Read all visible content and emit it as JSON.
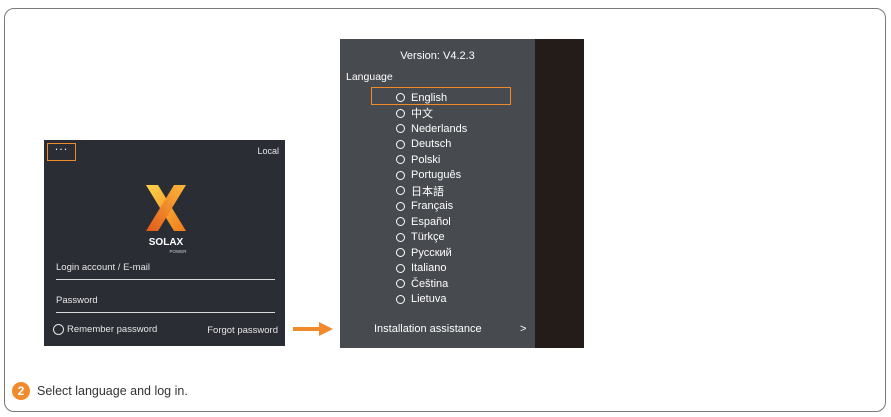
{
  "login": {
    "more_label": "···",
    "local_label": "Local",
    "brand_text": "SOLAX",
    "brand_sub": "POWER",
    "account_label": "Login account / E-mail",
    "password_label": "Password",
    "remember_label": "Remember password",
    "forgot_label": "Forgot password"
  },
  "menu": {
    "version": "Version: V4.2.3",
    "language_title": "Language",
    "languages": [
      "English",
      "中文",
      "Nederlands",
      "Deutsch",
      "Polski",
      "Português",
      "日本語",
      "Français",
      "Español",
      "Türkçe",
      "Русский",
      "Italiano",
      "Čeština",
      "Lietuva"
    ],
    "selected_language": "English",
    "installation_label": "Installation assistance",
    "installation_arrow": ">"
  },
  "step": {
    "number": "2",
    "text": "Select language and log in."
  },
  "colors": {
    "accent": "#f08a2b",
    "phone_bg": "#2b2d35",
    "menu_bg": "#474a4f"
  }
}
